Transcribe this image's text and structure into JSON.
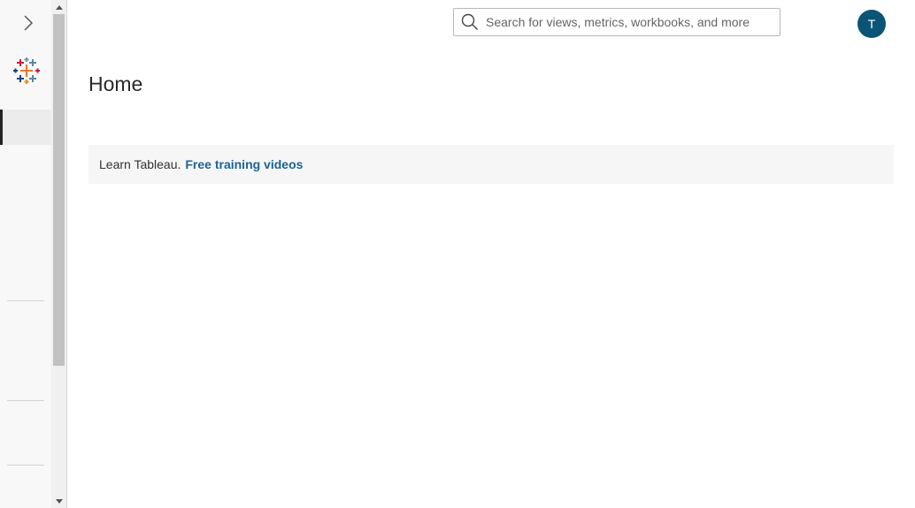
{
  "header": {
    "search_placeholder": "Search for views, metrics, workbooks, and more",
    "avatar_initial": "T"
  },
  "main": {
    "title": "Home",
    "banner": {
      "text": "Learn Tableau.",
      "link_label": "Free training videos"
    }
  },
  "sidebar": {
    "expand_icon": "chevron-right-icon",
    "logo_icon": "tableau-logo-icon"
  },
  "colors": {
    "avatar_bg": "#0a5575",
    "link": "#1a6496",
    "sidebar_bg": "#f8f8f8"
  }
}
